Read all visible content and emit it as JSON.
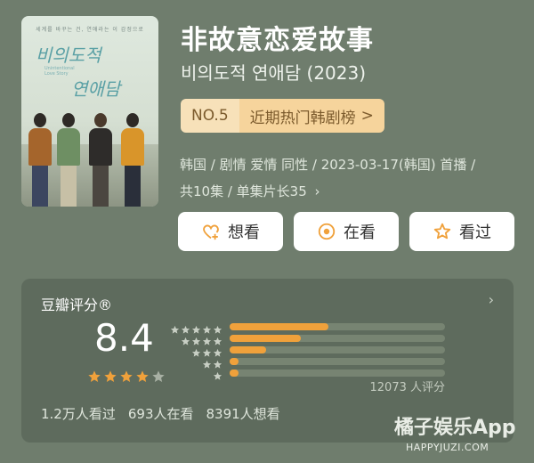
{
  "poster": {
    "tagline": "세계를 바꾸는 건, 연애라는 이 감정으로",
    "title_line1": "비의도적",
    "title_line2": "연애담",
    "english_line1": "Unintentional",
    "english_line2": "Love Story"
  },
  "header": {
    "title": "非故意恋爱故事",
    "subtitle": "비의도적 연애담 (2023)"
  },
  "rank": {
    "number": "NO.5",
    "list": "近期热门韩剧榜",
    "chevron": ">"
  },
  "meta": {
    "line1": "韩国 / 剧情 爱情 同性 / 2023-03-17(韩国) 首播 /",
    "line2": "共10集 / 单集片长35",
    "chevron": "›"
  },
  "actions": {
    "want": "想看",
    "watching": "在看",
    "watched": "看过",
    "want_icon": "heart-plus-icon",
    "watching_icon": "target-icon",
    "watched_icon": "star-outline-icon"
  },
  "rating": {
    "label": "豆瓣评分®",
    "chevron": "›",
    "score": "8.4",
    "stars_filled": 4,
    "stars_total": 5,
    "distribution": [
      {
        "stars": 5,
        "fraction": 0.46
      },
      {
        "stars": 4,
        "fraction": 0.33
      },
      {
        "stars": 3,
        "fraction": 0.17
      },
      {
        "stars": 2,
        "fraction": 0.04
      },
      {
        "stars": 1,
        "fraction": 0.04
      }
    ],
    "count": "12073 人评分",
    "stats": [
      "1.2万人看过",
      "693人在看",
      "8391人想看"
    ]
  },
  "watermark": {
    "brand": "橘子娱乐App",
    "url": "HAPPYJUZI.COM"
  },
  "colors": {
    "background": "#6f7d6d",
    "panel": "#5e6b5d",
    "star": "#f0a13b",
    "rank_bg": "#f6d49c"
  }
}
